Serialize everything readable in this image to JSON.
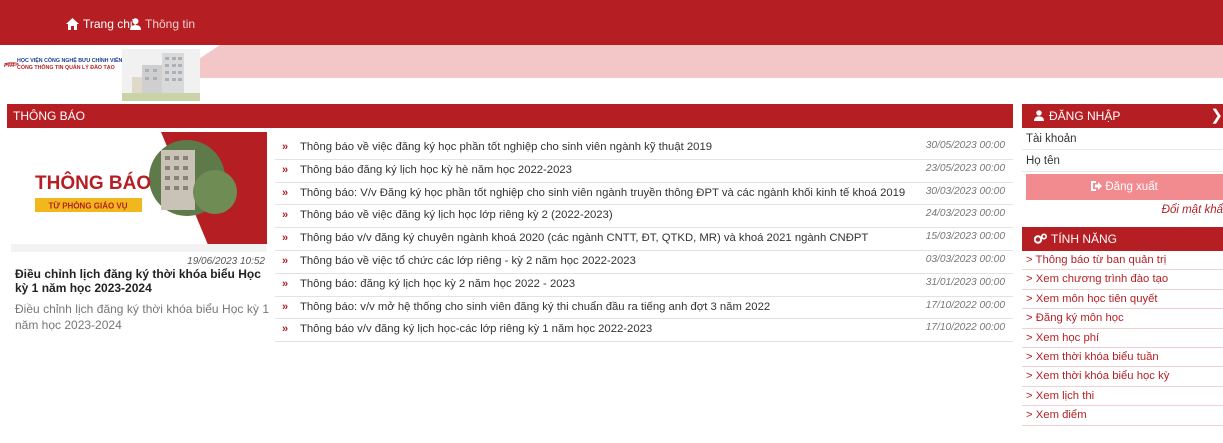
{
  "nav": {
    "home": "Trang chủ",
    "info": "Thông tin"
  },
  "logo": {
    "line1": "HỌC VIỆN CÔNG NGHỆ BƯU CHÍNH VIỄN THÔNG",
    "line2": "CỔNG THÔNG TIN QUẢN LÝ ĐÀO TẠO",
    "mark": "PTIT"
  },
  "announce": {
    "header": "THÔNG BÁO",
    "featured": {
      "image_title": "THÔNG BÁO",
      "image_sub": "TỪ PHÒNG GIÁO VỤ",
      "date": "19/06/2023 10:52",
      "title": "Điều chỉnh lịch đăng ký thời khóa biểu Học kỳ 1 năm học 2023-2024",
      "desc": "Điều chỉnh lịch đăng ký thời khóa biểu Học kỳ 1 năm học 2023-2024"
    },
    "items": [
      {
        "text": "Thông báo về việc đăng ký học phần tốt nghiệp cho sinh viên ngành kỹ thuật 2019",
        "date": "30/05/2023 00:00"
      },
      {
        "text": "Thông báo đăng ký lịch học kỳ hè năm học 2022-2023",
        "date": "23/05/2023 00:00"
      },
      {
        "text": "Thông báo: V/v Đăng ký học phần tốt nghiệp cho sinh viên ngành truyền thông ĐPT và các ngành khối kinh tế khoá 2019",
        "date": "30/03/2023 00:00"
      },
      {
        "text": "Thông báo về việc đăng ký lịch học lớp riêng kỳ 2 (2022-2023)",
        "date": "24/03/2023 00:00"
      },
      {
        "text": "Thông báo v/v đăng ký chuyên ngành khoá 2020 (các ngành CNTT, ĐT, QTKD, MR) và khoá 2021 ngành CNĐPT",
        "date": "15/03/2023 00:00"
      },
      {
        "text": "Thông báo về việc tổ chức các lớp riêng - kỳ 2 năm học 2022-2023",
        "date": "03/03/2023 00:00"
      },
      {
        "text": "Thông báo: đăng ký lịch học kỳ 2 năm học 2022 - 2023",
        "date": "31/01/2023 00:00"
      },
      {
        "text": "Thông báo: v/v mở hệ thống cho sinh viên đăng ký thi chuẩn đầu ra tiếng anh đợt 3 năm 2022",
        "date": "17/10/2022 00:00"
      },
      {
        "text": "Thông báo v/v đăng ký lịch học-các lớp riêng kỳ 1 năm học 2022-2023",
        "date": "17/10/2022 00:00"
      }
    ]
  },
  "login": {
    "header": "ĐĂNG NHẬP",
    "account_label": "Tài khoản",
    "name_label": "Họ tên",
    "logout": "Đăng xuất",
    "change_password": "Đổi mật khẩ"
  },
  "features": {
    "header": "TÍNH NĂNG",
    "items": [
      "Thông báo từ ban quản trị",
      "Xem chương trình đào tạo",
      "Xem môn học tiên quyết",
      "Đăng ký môn học",
      "Xem học phí",
      "Xem thời khóa biểu tuần",
      "Xem thời khóa biểu học kỳ",
      "Xem lịch thi",
      "Xem điểm"
    ]
  },
  "colors": {
    "brand": "#b51f24",
    "band": "#f3c7c8"
  }
}
